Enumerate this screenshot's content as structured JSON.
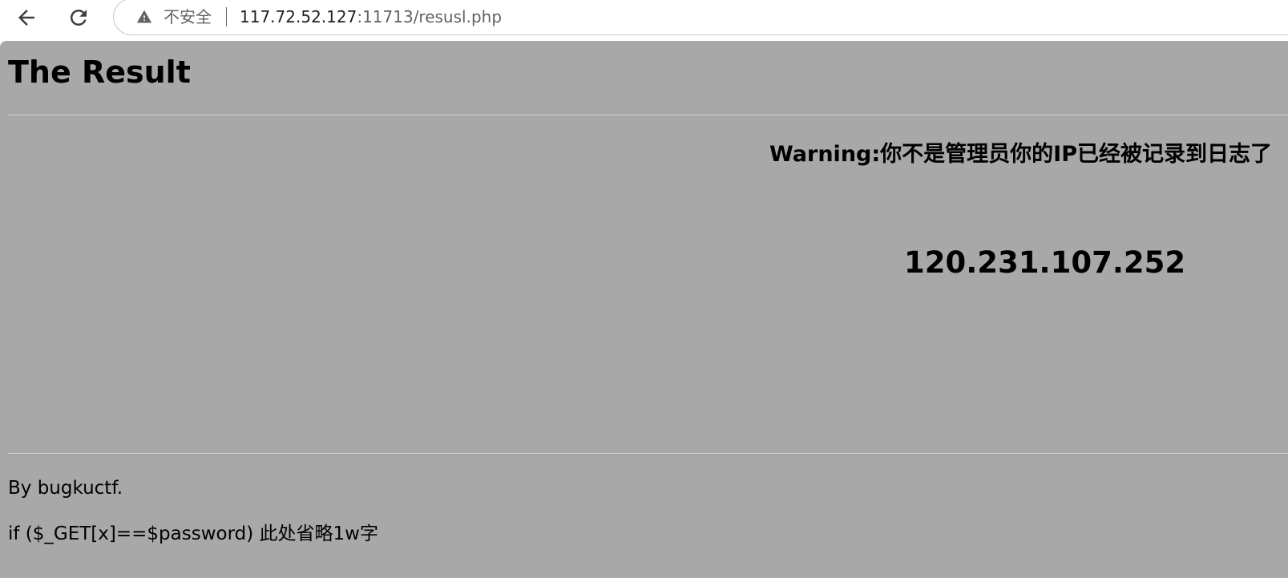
{
  "browser": {
    "back_icon": "arrow-left-icon",
    "reload_icon": "reload-icon",
    "security_icon": "warning-triangle-icon",
    "security_label": "不安全",
    "url_host": "117.72.52.127",
    "url_rest": ":11713/resusl.php"
  },
  "page": {
    "background_color": "#a8a8a8",
    "title": "The Result",
    "warning": "Warning:你不是管理员你的IP已经被记录到日志了",
    "ip": "120.231.107.252",
    "footer_by": "By bugkuctf.",
    "footer_code": "if ($_GET[x]==$password) 此处省略1w字"
  }
}
